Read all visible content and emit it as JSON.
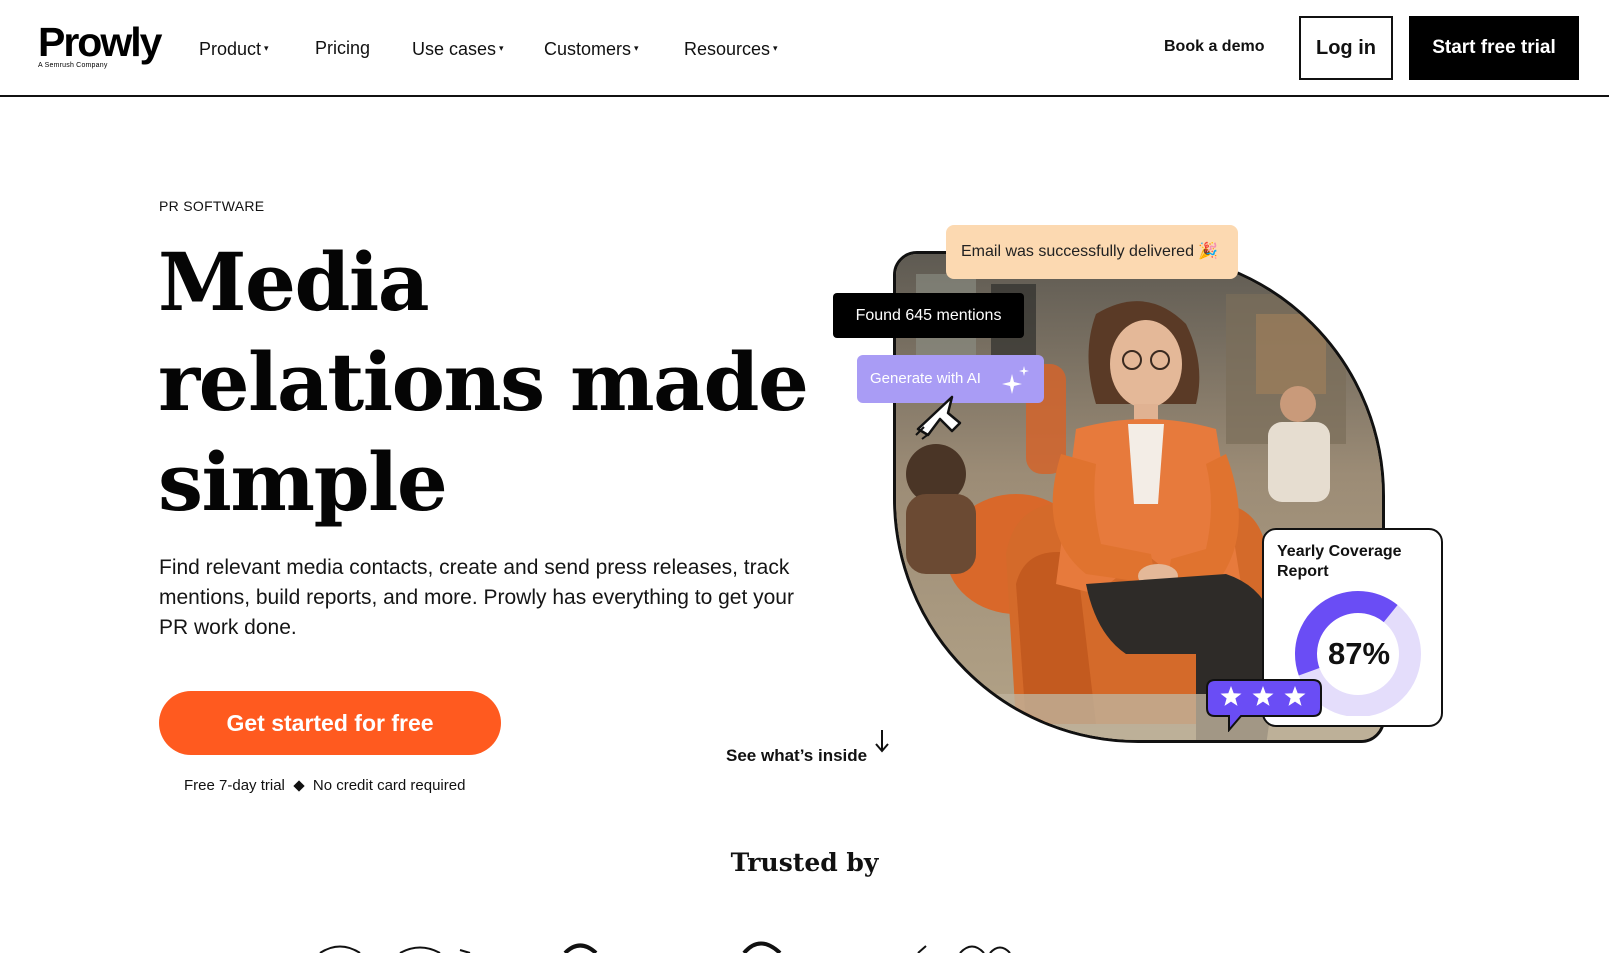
{
  "header": {
    "logo_text": "Prowly",
    "logo_subtitle": "A Semrush Company",
    "nav": [
      {
        "label": "Product",
        "has_dropdown": true
      },
      {
        "label": "Pricing",
        "has_dropdown": false
      },
      {
        "label": "Use cases",
        "has_dropdown": true
      },
      {
        "label": "Customers",
        "has_dropdown": true
      },
      {
        "label": "Resources",
        "has_dropdown": true
      }
    ],
    "caret": "▾",
    "book_demo": "Book a demo",
    "login": "Log in",
    "start_trial": "Start free trial"
  },
  "hero": {
    "eyebrow": "PR SOFTWARE",
    "headline": [
      "Media",
      "relations made",
      "simple"
    ],
    "subtext": "Find relevant media contacts, create and send press releases, track mentions, build reports, and more. Prowly has everything to get your PR work done.",
    "cta": "Get started for free",
    "fine_print": [
      "Free 7-day trial",
      "No credit card required"
    ],
    "see_inside": "See what’s inside"
  },
  "visual": {
    "email_toast": "Email was successfully delivered 🎉",
    "mentions_badge": "Found 645 mentions",
    "generate_ai": "Generate with AI",
    "report_title": "Yearly Coverage Report",
    "report_percent": "87%",
    "report_fraction": 0.87,
    "stars_count": 3
  },
  "trusted": {
    "title": "Trusted by"
  },
  "colors": {
    "accent_orange": "#ff5a1f",
    "ai_purple": "#a99cf5",
    "gauge_purple": "#6a4df5",
    "gauge_track": "#e4ddfb",
    "toast_peach": "#fcd9b1",
    "stars_blue": "#6a4df5"
  },
  "icons": {
    "dropdown": "chevron-down-icon",
    "arrow": "arrow-down-icon",
    "sparkle": "sparkle-icon",
    "cursor": "pointer-cursor-icon",
    "star": "star-icon"
  }
}
